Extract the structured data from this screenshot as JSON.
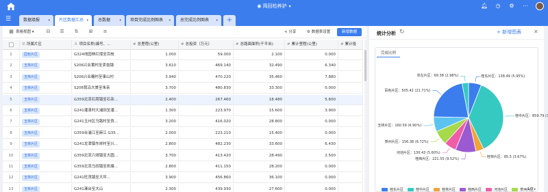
{
  "app": {
    "title": "简回检养护",
    "title_icon": "eye-icon",
    "right_icons": [
      "bell-icon",
      "history-icon",
      "settings-icon",
      "more-icon"
    ]
  },
  "tabs": [
    {
      "label": "数据填报"
    },
    {
      "label": "片区数据汇总",
      "active": true
    },
    {
      "label": "总数据"
    },
    {
      "label": "项目完成比例图表"
    },
    {
      "label": "总完成比例图表"
    }
  ],
  "toolbar": {
    "view_label": "表格视图",
    "share_label": "分享",
    "settings_label": "数据表设置",
    "add_label": "新增数据"
  },
  "table": {
    "columns": [
      "所属片区",
      "项目名称(编号、...",
      "总里程(公里)",
      "总投资（万元）",
      "总路面面积(千平米)",
      "累计里程(公里)",
      "累计投"
    ],
    "rows": [
      {
        "idx": "1",
        "district": "园色片区",
        "name": "G324线园林红煤至百枝",
        "mileage": "1.000",
        "invest": "59.000",
        "area": "2.100",
        "cum": "0.000"
      },
      {
        "idx": "2",
        "district": "玉林片区",
        "name": "S206兴业莆村至卖翁镇",
        "mileage": "3.610",
        "invest": "469.140",
        "area": "32.490",
        "cum": "6.340"
      },
      {
        "idx": "3",
        "district": "玉林片区",
        "name": "S206兴业糖村至事山村",
        "mileage": "3.940",
        "invest": "470.220",
        "area": "35.460",
        "cum": "7.880"
      },
      {
        "idx": "4",
        "district": "玉林片区",
        "name": "S206我沿大棠至朱亲",
        "mileage": "3.700",
        "invest": "480.830",
        "area": "33.300",
        "cum": "0.000"
      },
      {
        "idx": "5",
        "district": "玉林片区",
        "name": "G359北流石窝镇至石亲...",
        "mileage": "2.400",
        "invest": "267.460",
        "area": "18.480",
        "cum": "5.600",
        "selected": true
      },
      {
        "idx": "6",
        "district": "玉林片区",
        "name": "G241灌清村大浦田至灌...",
        "mileage": "1.300",
        "invest": "223.970",
        "area": "15.600",
        "cum": "3.900"
      },
      {
        "idx": "7",
        "district": "玉林片区",
        "name": "G241玉州区乌路村至良...",
        "mileage": "3.200",
        "invest": "416.020",
        "area": "28.800",
        "cum": "0.000"
      },
      {
        "idx": "8",
        "district": "玉林片区",
        "name": "G359合浦江至麻江 G35...",
        "mileage": "2.000",
        "invest": "223.210",
        "area": "15.400",
        "cum": "0.000"
      },
      {
        "idx": "9",
        "district": "玉林片区",
        "name": "G241龙潭镇东岸村至兴...",
        "mileage": "2.800",
        "invest": "482.230",
        "area": "33.600",
        "cum": "6.430"
      },
      {
        "idx": "10",
        "district": "玉林片区",
        "name": "G359北流六靖镇至大圆...",
        "mileage": "3.700",
        "invest": "413.420",
        "area": "28.490",
        "cum": "2.500"
      },
      {
        "idx": "11",
        "district": "玉林片区",
        "name": "G359北流马田镇至凯塘...",
        "mileage": "2.800",
        "invest": "411.150",
        "area": "28.200",
        "cum": "0.000"
      },
      {
        "idx": "12",
        "district": "玉林片区",
        "name": "G241旺茂镇至大坪...",
        "mileage": "3.900",
        "invest": "456.860",
        "area": "36.100",
        "cum": "0.000"
      },
      {
        "idx": "13",
        "district": "玉林片区",
        "name": "G241溱台至大山",
        "mileage": "2.300",
        "invest": "439.930",
        "area": "27.600",
        "cum": "0.000"
      }
    ]
  },
  "stats": {
    "title": "统计分析",
    "add_chart_label": "+ 新增图表",
    "card_tab": "完成比例",
    "pager": "1/2",
    "colors": [
      "#3b7ded",
      "#36c9c1",
      "#f2a33a",
      "#9b5ad1",
      "#ef5da8",
      "#a6d94b",
      "#5cc3f0"
    ]
  },
  "chart_data": {
    "type": "pie",
    "title": "完成比例",
    "slices": [
      {
        "name": "桂东片区",
        "value": 138.49,
        "pct": "5.95%",
        "label": "桂东片区：138.49 (5.95%)"
      },
      {
        "name": "桂中片区",
        "value": 859.79,
        "pct": "36.94%",
        "label": "桂中片区：859.79 (36.94%)"
      },
      {
        "name": "桂林片区",
        "value": 85.5,
        "pct": "3.67%",
        "label": "桂林片区：85.5 (3.67%)"
      },
      {
        "name": "桂西片区",
        "value": 221.55,
        "pct": "9.52%",
        "label": "桂西片区：221.55 (9.52%)"
      },
      {
        "name": "河池片区",
        "value": 130.43,
        "pct": "5.60%",
        "label": "河池片区：130.43 (5.60%)"
      },
      {
        "name": "贺州片区",
        "value": 156.38,
        "pct": "6.72%",
        "label": "贺州片区：156.38 (6.72%)"
      },
      {
        "name": "玉林片区",
        "value": 160.59,
        "pct": "6.90%",
        "label": "玉林片区：160.59 (6.90%)"
      },
      {
        "name": "百色片区",
        "value": 505.42,
        "pct": "21.71%",
        "label": "百色片区：505.42 (21.71%)"
      },
      {
        "name": "崇左片区",
        "value": 69.38,
        "pct": "2.98%",
        "label": "崇左片区：69.38 (2.98%)"
      }
    ],
    "legend": [
      "桂东片区",
      "桂中片区",
      "桂林片区",
      "桂西片区",
      "河池片区",
      "贺州片区"
    ]
  }
}
